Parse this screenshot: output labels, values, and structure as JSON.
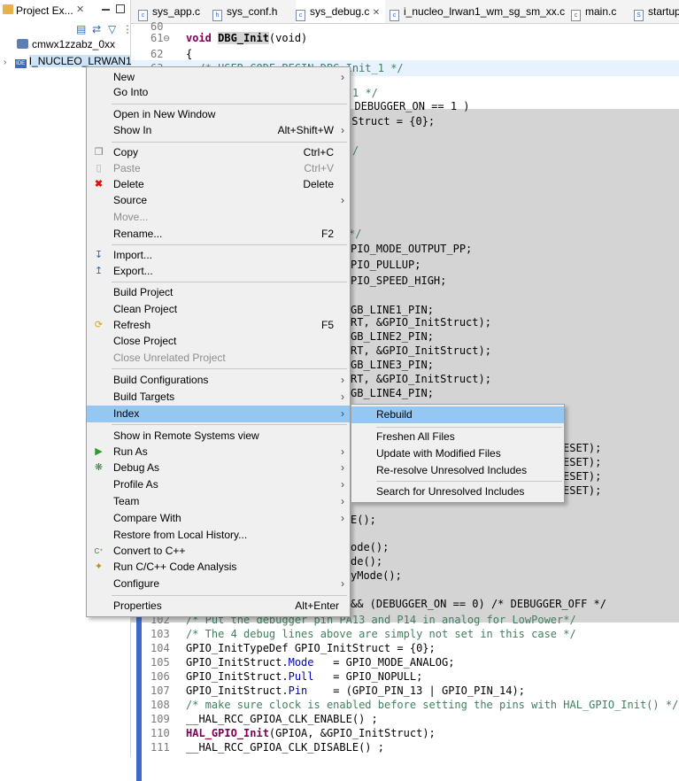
{
  "explorer": {
    "tab_title": "Project Ex...",
    "tab_close": "✕",
    "items": [
      {
        "label": "cmwx1zzabz_0xx",
        "kind": "project"
      },
      {
        "label": "I_NUCLEO_LRWAN1",
        "kind": "ide-project",
        "badge": "IDE"
      }
    ]
  },
  "editor": {
    "tabs": [
      {
        "label": "sys_app.c"
      },
      {
        "label": "sys_conf.h"
      },
      {
        "label": "sys_debug.c",
        "close": "✕"
      },
      {
        "label": "i_nucleo_lrwan1_wm_sg_sm_xx.c"
      },
      {
        "label": "main.c"
      },
      {
        "label": "startup"
      }
    ],
    "lines": [
      {
        "n": "60",
        "text": ""
      },
      {
        "n": "61⊖",
        "pre": "void ",
        "fn": "DBG_Init",
        "post": "(void)"
      },
      {
        "n": "62",
        "text": "{"
      },
      {
        "n": "63",
        "text": "  /* USER CODE BEGIN DBG_Init_1 */"
      }
    ],
    "visible_right_fragments": [
      "1 */",
      "( DEBUGGER_ON == 1 )",
      "tStruct = {0};",
      "/",
      "*/",
      "PIO_MODE_OUTPUT_PP;",
      "PIO_PULLUP;",
      "PIO_SPEED_HIGH;",
      "GB_LINE1_PIN;",
      "RT, &GPIO_InitStruct);",
      "GB_LINE2_PIN;",
      "RT, &GPIO_InitStruct);",
      "GB_LINE3_PIN;",
      "RT, &GPIO_InitStruct);",
      "GB_LINE4_PIN;",
      "ESET);",
      "ESET);",
      "ESET);",
      "ESET);",
      "E();",
      "ode();",
      "de();",
      "yMode();",
      "&& (DEBUGGER_ON == 0) /* DEBUGGER_OFF */"
    ],
    "bottom_lines": [
      {
        "n": "102",
        "text": "/* Put the debugger pin PA13 and P14 in analog for LowPower*/"
      },
      {
        "n": "103",
        "text": "/* The 4 debug lines above are simply not set in this case */"
      },
      {
        "n": "104",
        "text": "GPIO_InitTypeDef GPIO_InitStruct = {0};"
      },
      {
        "n": "105",
        "a": "GPIO_InitStruct.",
        "f": "Mode",
        "b": "   = GPIO_MODE_ANALOG;"
      },
      {
        "n": "106",
        "a": "GPIO_InitStruct.",
        "f": "Pull",
        "b": "   = GPIO_NOPULL;"
      },
      {
        "n": "107",
        "a": "GPIO_InitStruct.",
        "f": "Pin",
        "b": "    = (GPIO_PIN_13 | GPIO_PIN_14);"
      },
      {
        "n": "108",
        "text": "/* make sure clock is enabled before setting the pins with HAL_GPIO_Init() */"
      },
      {
        "n": "109",
        "text": "__HAL_RCC_GPIOA_CLK_ENABLE() ;"
      },
      {
        "n": "110",
        "fnb": "HAL_GPIO_Init",
        "post": "(GPIOA, &GPIO_InitStruct);"
      },
      {
        "n": "111",
        "text": "__HAL_RCC_GPIOA_CLK_DISABLE() ;"
      }
    ]
  },
  "context_menu": {
    "items": [
      {
        "label": "New",
        "submenu": true
      },
      {
        "label": "Go Into"
      },
      {
        "sep": true
      },
      {
        "label": "Open in New Window"
      },
      {
        "label": "Show In",
        "accel": "Alt+Shift+W",
        "submenu": true
      },
      {
        "sep": true
      },
      {
        "label": "Copy",
        "accel": "Ctrl+C",
        "icon": "copy-icon"
      },
      {
        "label": "Paste",
        "accel": "Ctrl+V",
        "icon": "paste-icon",
        "disabled": true
      },
      {
        "label": "Delete",
        "accel": "Delete",
        "icon": "delete-icon"
      },
      {
        "label": "Source",
        "submenu": true
      },
      {
        "label": "Move...",
        "disabled": true
      },
      {
        "label": "Rename...",
        "accel": "F2"
      },
      {
        "sep": true
      },
      {
        "label": "Import...",
        "icon": "import-icon"
      },
      {
        "label": "Export...",
        "icon": "export-icon"
      },
      {
        "sep": true
      },
      {
        "label": "Build Project"
      },
      {
        "label": "Clean Project"
      },
      {
        "label": "Refresh",
        "accel": "F5",
        "icon": "refresh-icon"
      },
      {
        "label": "Close Project"
      },
      {
        "label": "Close Unrelated Project",
        "disabled": true
      },
      {
        "sep": true
      },
      {
        "label": "Build Configurations",
        "submenu": true
      },
      {
        "label": "Build Targets",
        "submenu": true
      },
      {
        "label": "Index",
        "submenu": true,
        "highlighted": true
      },
      {
        "sep": true
      },
      {
        "label": "Show in Remote Systems view"
      },
      {
        "label": "Run As",
        "submenu": true,
        "icon": "run-icon"
      },
      {
        "label": "Debug As",
        "submenu": true,
        "icon": "debug-icon"
      },
      {
        "label": "Profile As",
        "submenu": true
      },
      {
        "label": "Team",
        "submenu": true
      },
      {
        "label": "Compare With",
        "submenu": true
      },
      {
        "label": "Restore from Local History..."
      },
      {
        "label": "Convert to C++",
        "icon": "convert-cpp-icon"
      },
      {
        "label": "Run C/C++ Code Analysis",
        "icon": "code-analysis-icon"
      },
      {
        "label": "Configure",
        "submenu": true
      },
      {
        "sep": true
      },
      {
        "label": "Properties",
        "accel": "Alt+Enter"
      }
    ]
  },
  "index_submenu": {
    "items": [
      {
        "label": "Rebuild",
        "highlighted": true
      },
      {
        "sep": true
      },
      {
        "label": "Freshen All Files"
      },
      {
        "label": "Update with Modified Files"
      },
      {
        "label": "Re-resolve Unresolved Includes"
      },
      {
        "sep": true
      },
      {
        "label": "Search for Unresolved Includes"
      }
    ]
  },
  "colors": {
    "highlight": "#95c7f3",
    "keyword": "#7f0055",
    "comment": "#3f7f5f",
    "field": "#0000c0"
  }
}
